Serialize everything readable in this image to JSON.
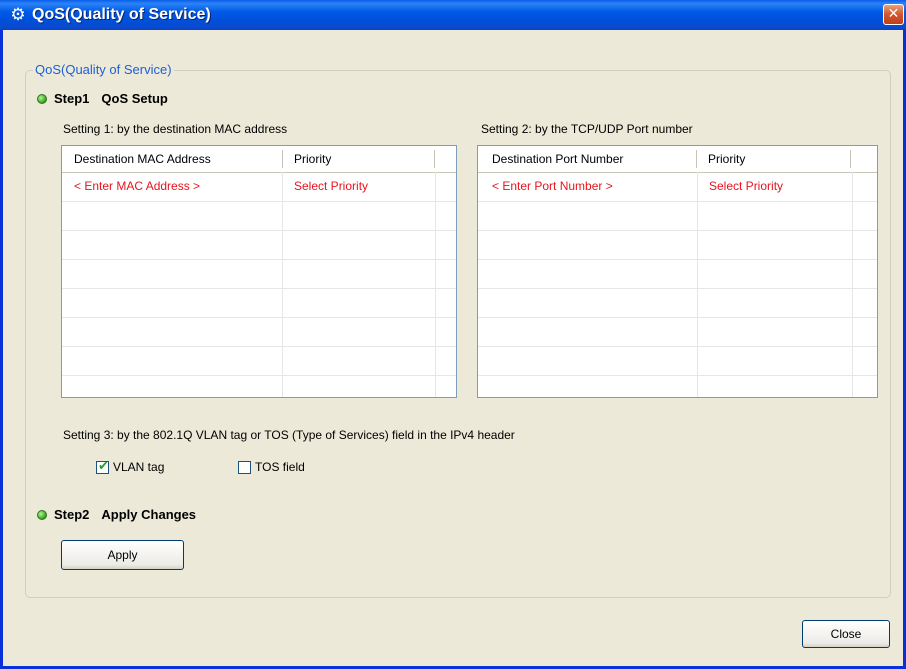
{
  "window": {
    "title": "QoS(Quality of Service)",
    "icon": "gear-app-icon",
    "close_glyph": "✕"
  },
  "group": {
    "legend": "QoS(Quality of Service)"
  },
  "step1": {
    "label": "Step1",
    "title": "QoS Setup"
  },
  "setting1": {
    "caption": "Setting 1: by the destination MAC address",
    "columns": [
      "Destination MAC Address",
      "Priority"
    ],
    "rows": [
      [
        "< Enter MAC Address >",
        "Select Priority"
      ]
    ]
  },
  "setting2": {
    "caption": "Setting 2: by the TCP/UDP Port number",
    "columns": [
      "Destination Port Number",
      "Priority"
    ],
    "rows": [
      [
        "< Enter Port Number >",
        "Select Priority"
      ]
    ]
  },
  "setting3": {
    "caption": "Setting 3: by the 802.1Q VLAN tag or TOS (Type of Services) field in the IPv4 header",
    "vlan_label": "VLAN tag",
    "vlan_checked": true,
    "tos_label": "TOS field",
    "tos_checked": false,
    "check_glyph": "✔"
  },
  "step2": {
    "label": "Step2",
    "title": "Apply Changes"
  },
  "buttons": {
    "apply": "Apply",
    "close": "Close"
  },
  "colors": {
    "title_bar": "#0058e6",
    "placeholder_text": "#e8141e",
    "legend_text": "#1f5fd6",
    "step_dot": "#2fa21a"
  }
}
